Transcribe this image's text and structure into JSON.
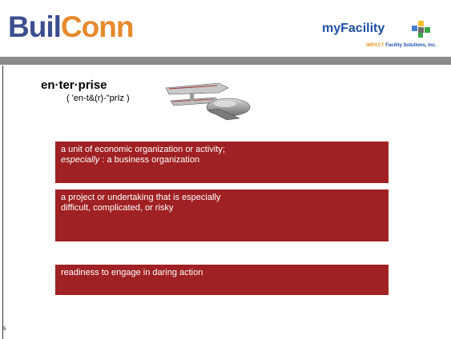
{
  "header": {
    "logo_left_part1": "Buil",
    "logo_left_part2": "Conn",
    "logo_right_name": "myFacility",
    "logo_right_impact": "IMPACT",
    "logo_right_company": " Facility Solutions, Inc."
  },
  "definition": {
    "term": "en·ter·prise",
    "pronunciation": "( 'en-t&(r)-\"prIz )",
    "senses": [
      {
        "before": "a unit of economic organization or activity; ",
        "emphasis": "especially",
        "after": " : a business organization"
      },
      {
        "text": "a project or undertaking that is especially difficult, complicated, or risky"
      },
      {
        "text": "readiness to engage in daring action"
      }
    ]
  },
  "slide": {
    "page_number": "5"
  },
  "colors": {
    "accent_red": "#a02124",
    "bar_grey": "#8c8c8c",
    "logo_blue": "#3d4e8f",
    "logo_orange": "#e68a2e"
  }
}
